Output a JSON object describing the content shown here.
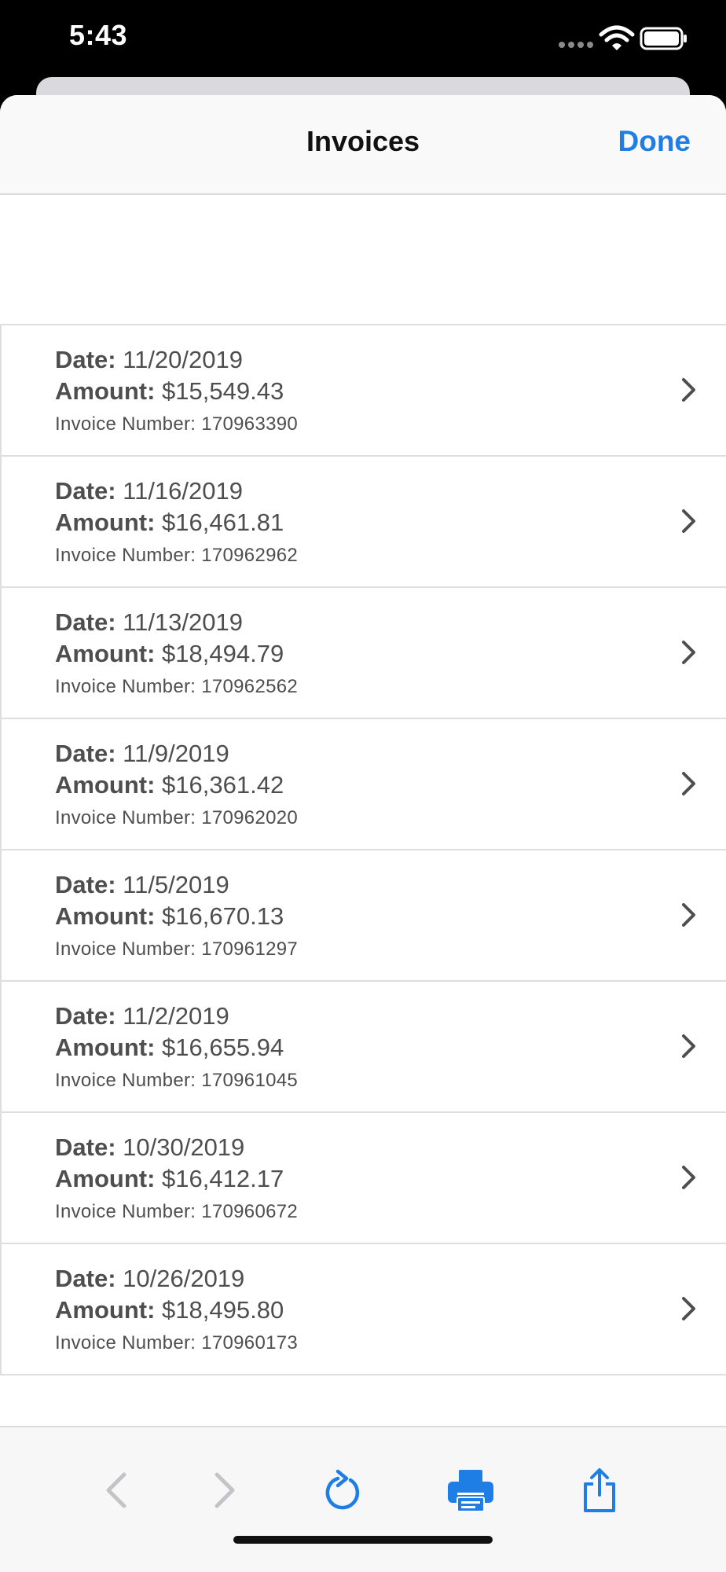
{
  "status_bar": {
    "time": "5:43"
  },
  "nav": {
    "title": "Invoices",
    "done_label": "Done"
  },
  "labels": {
    "date": "Date:",
    "amount": "Amount:",
    "invoice_number": "Invoice Number:"
  },
  "invoices": [
    {
      "date": "11/20/2019",
      "amount": "$15,549.43",
      "number": "170963390"
    },
    {
      "date": "11/16/2019",
      "amount": "$16,461.81",
      "number": "170962962"
    },
    {
      "date": "11/13/2019",
      "amount": "$18,494.79",
      "number": "170962562"
    },
    {
      "date": "11/9/2019",
      "amount": "$16,361.42",
      "number": "170962020"
    },
    {
      "date": "11/5/2019",
      "amount": "$16,670.13",
      "number": "170961297"
    },
    {
      "date": "11/2/2019",
      "amount": "$16,655.94",
      "number": "170961045"
    },
    {
      "date": "10/30/2019",
      "amount": "$16,412.17",
      "number": "170960672"
    },
    {
      "date": "10/26/2019",
      "amount": "$18,495.80",
      "number": "170960173"
    }
  ],
  "toolbar": {
    "buttons": [
      {
        "icon": "back-chevron-icon",
        "enabled": false
      },
      {
        "icon": "forward-chevron-icon",
        "enabled": false
      },
      {
        "icon": "refresh-icon",
        "enabled": true
      },
      {
        "icon": "print-icon",
        "enabled": true
      },
      {
        "icon": "share-icon",
        "enabled": true
      }
    ]
  },
  "colors": {
    "accent": "#1f7ee6",
    "disabled": "#c4c4c8",
    "text": "#4e4e4e"
  }
}
